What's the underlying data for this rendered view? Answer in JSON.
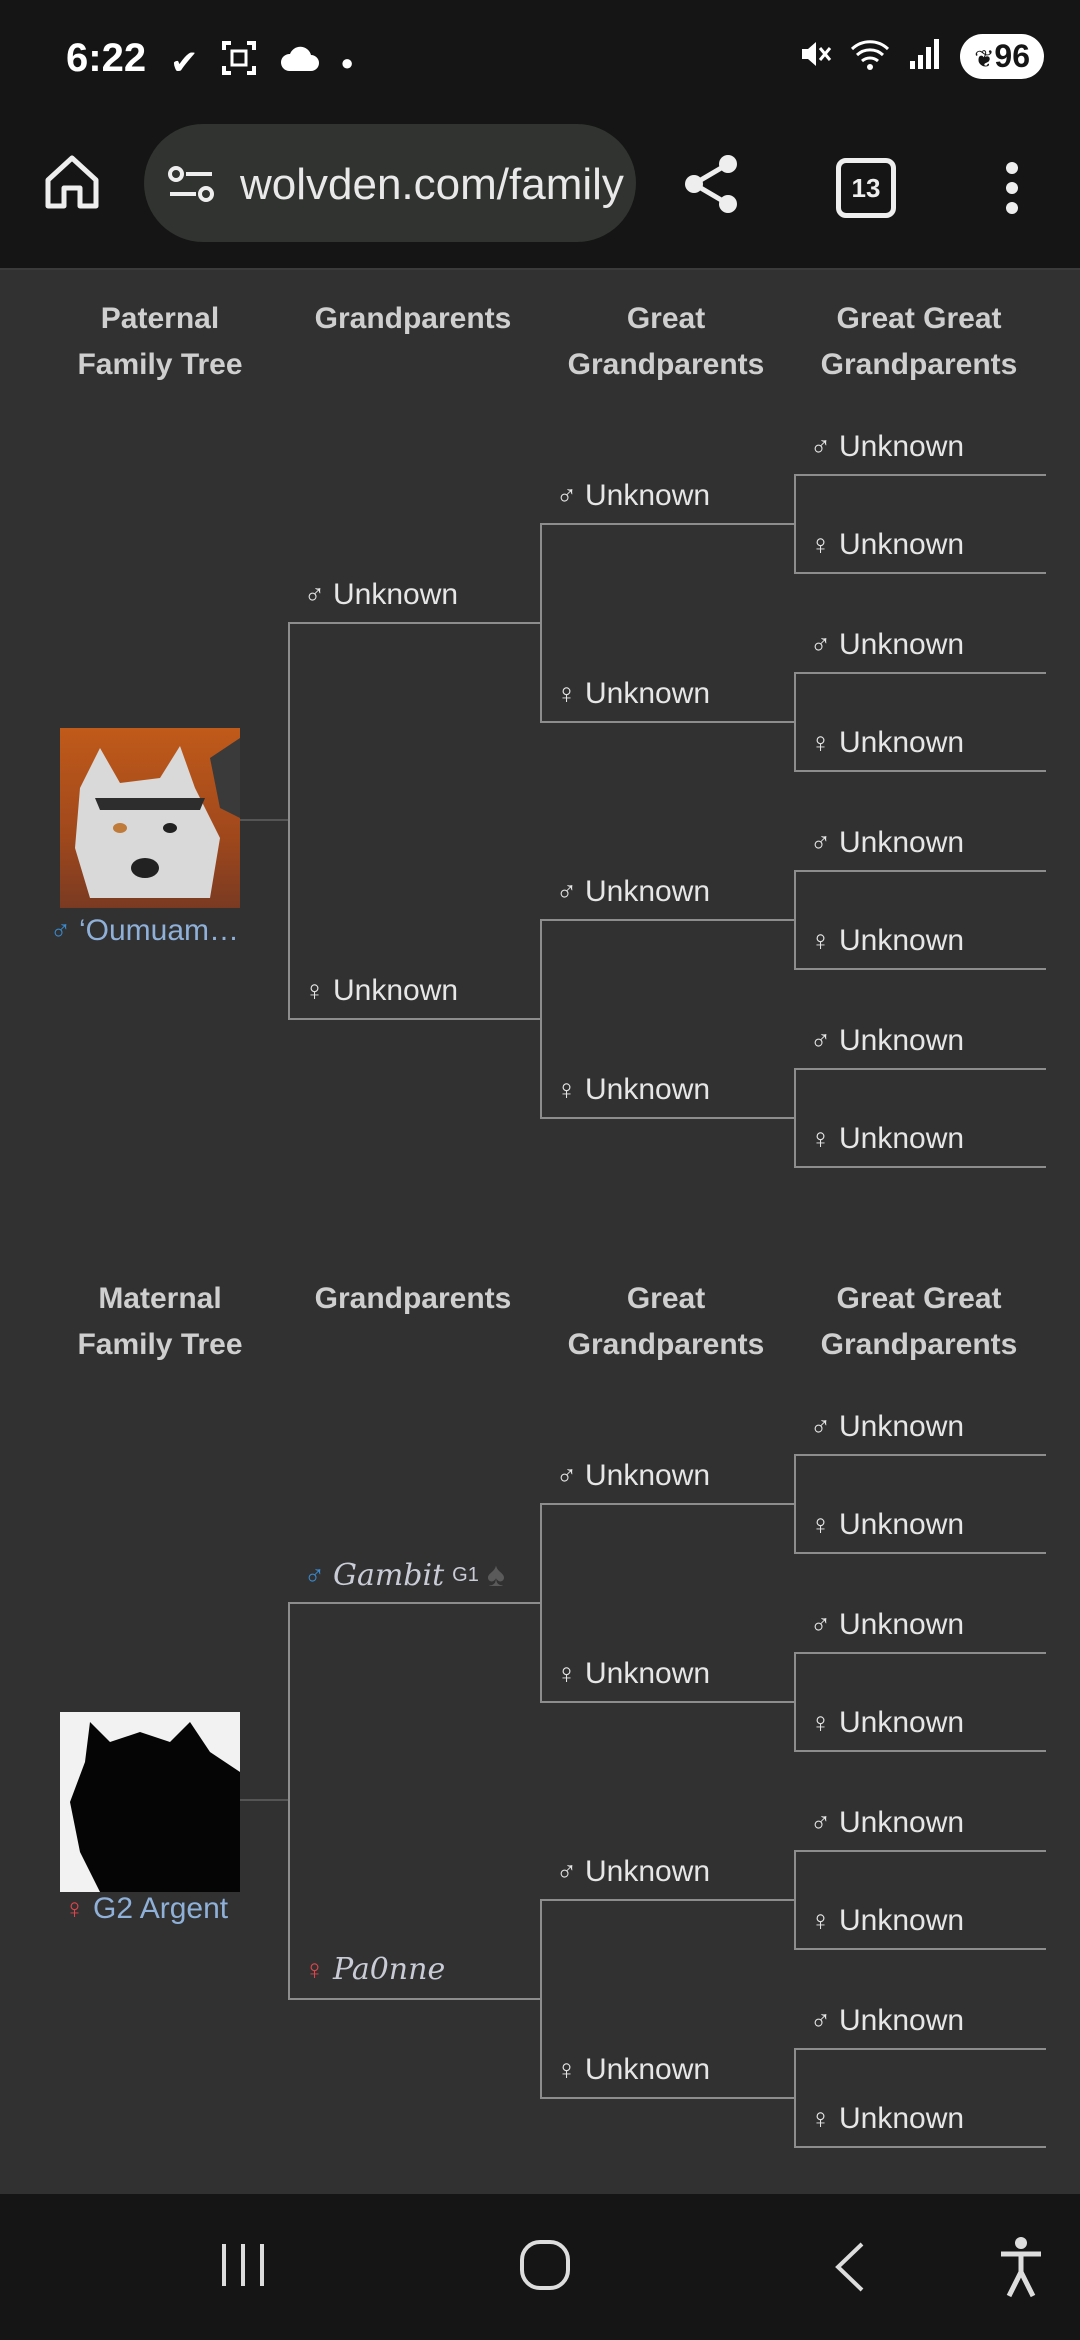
{
  "status": {
    "time": "6:22",
    "battery": "96"
  },
  "browser": {
    "url": "wolvden.com/family",
    "tab_count": "13"
  },
  "paternal": {
    "headers": [
      "Paternal Family Tree",
      "Grandparents",
      "Great Grandparents",
      "Great Great Grandparents"
    ],
    "root_symbol": "♂",
    "root_name": "‘Oumuam…",
    "gp1_symbol": "♂",
    "gp1_name": "Unknown",
    "gp2_symbol": "♀",
    "gp2_name": "Unknown",
    "ggp": [
      {
        "sym": "♂",
        "name": "Unknown"
      },
      {
        "sym": "♀",
        "name": "Unknown"
      },
      {
        "sym": "♂",
        "name": "Unknown"
      },
      {
        "sym": "♀",
        "name": "Unknown"
      }
    ],
    "gggp": [
      {
        "sym": "♂",
        "name": "Unknown"
      },
      {
        "sym": "♀",
        "name": "Unknown"
      },
      {
        "sym": "♂",
        "name": "Unknown"
      },
      {
        "sym": "♀",
        "name": "Unknown"
      },
      {
        "sym": "♂",
        "name": "Unknown"
      },
      {
        "sym": "♀",
        "name": "Unknown"
      },
      {
        "sym": "♂",
        "name": "Unknown"
      },
      {
        "sym": "♀",
        "name": "Unknown"
      }
    ]
  },
  "maternal": {
    "headers": [
      "Maternal Family Tree",
      "Grandparents",
      "Great Grandparents",
      "Great Great Grandparents"
    ],
    "root_symbol": "♀",
    "root_name": "G2 Argent",
    "gp1_symbol": "♂",
    "gp1_name": "Gambit",
    "gp1_suffix": "G1",
    "gp2_symbol": "♀",
    "gp2_name": "Pa0nne",
    "ggp": [
      {
        "sym": "♂",
        "name": "Unknown"
      },
      {
        "sym": "♀",
        "name": "Unknown"
      },
      {
        "sym": "♂",
        "name": "Unknown"
      },
      {
        "sym": "♀",
        "name": "Unknown"
      }
    ],
    "gggp": [
      {
        "sym": "♂",
        "name": "Unknown"
      },
      {
        "sym": "♀",
        "name": "Unknown"
      },
      {
        "sym": "♂",
        "name": "Unknown"
      },
      {
        "sym": "♀",
        "name": "Unknown"
      },
      {
        "sym": "♂",
        "name": "Unknown"
      },
      {
        "sym": "♀",
        "name": "Unknown"
      },
      {
        "sym": "♂",
        "name": "Unknown"
      },
      {
        "sym": "♀",
        "name": "Unknown"
      }
    ]
  },
  "icons": [
    "home-icon",
    "site-settings-icon",
    "share-icon",
    "tabs-icon",
    "more-menu-icon",
    "recents-icon",
    "home-nav-icon",
    "back-icon",
    "accessibility-icon"
  ],
  "colors": {
    "background": "#313131",
    "bar": "#141514",
    "male": "#3a8bd1",
    "female": "#e0454d",
    "link": "#8fb0d8"
  }
}
